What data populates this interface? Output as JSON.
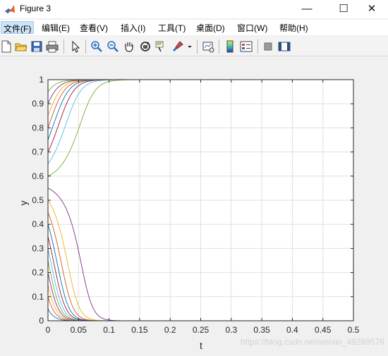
{
  "window": {
    "title": "Figure 3",
    "minimize_glyph": "—",
    "maximize_glyph": "☐",
    "close_glyph": "✕"
  },
  "menu": {
    "items": [
      {
        "label": "文件(F)"
      },
      {
        "label": "编辑(E)"
      },
      {
        "label": "查看(V)"
      },
      {
        "label": "插入(I)"
      },
      {
        "label": "工具(T)"
      },
      {
        "label": "桌面(D)"
      },
      {
        "label": "窗口(W)"
      },
      {
        "label": "帮助(H)"
      }
    ],
    "active_index": 0
  },
  "toolbar": {
    "icons": [
      "new-file-icon",
      "open-folder-icon",
      "save-icon",
      "print-icon",
      "pointer-icon",
      "zoom-in-icon",
      "zoom-out-icon",
      "pan-hand-icon",
      "rotate-3d-icon",
      "data-cursor-icon",
      "brush-icon",
      "dropdown-arrow-icon",
      "link-plot-icon",
      "colorbar-icon",
      "legend-icon",
      "hide-plot-tools-icon",
      "show-plot-tools-icon"
    ]
  },
  "watermark": "https://blog.csdn.net/weixin_49289576",
  "chart_data": {
    "type": "line",
    "title": "",
    "xlabel": "t",
    "ylabel": "y",
    "xlim": [
      0,
      0.5
    ],
    "ylim": [
      0,
      1
    ],
    "xticks": [
      "0",
      "0.05",
      "0.1",
      "0.15",
      "0.2",
      "0.25",
      "0.3",
      "0.35",
      "0.4",
      "0.45",
      "0.5"
    ],
    "yticks": [
      "0",
      "0.1",
      "0.2",
      "0.3",
      "0.4",
      "0.5",
      "0.6",
      "0.7",
      "0.8",
      "0.9",
      "1"
    ],
    "grid": true,
    "initial_values": [
      0.05,
      0.1,
      0.15,
      0.2,
      0.25,
      0.3,
      0.35,
      0.4,
      0.45,
      0.5,
      0.55,
      0.6,
      0.65,
      0.7,
      0.75,
      0.8,
      0.85,
      0.9,
      0.95
    ],
    "series_colors": [
      "#0072BD",
      "#D95319",
      "#EDB120",
      "#7E2F8E",
      "#77AC30",
      "#4DBEEE",
      "#A2142F"
    ]
  }
}
